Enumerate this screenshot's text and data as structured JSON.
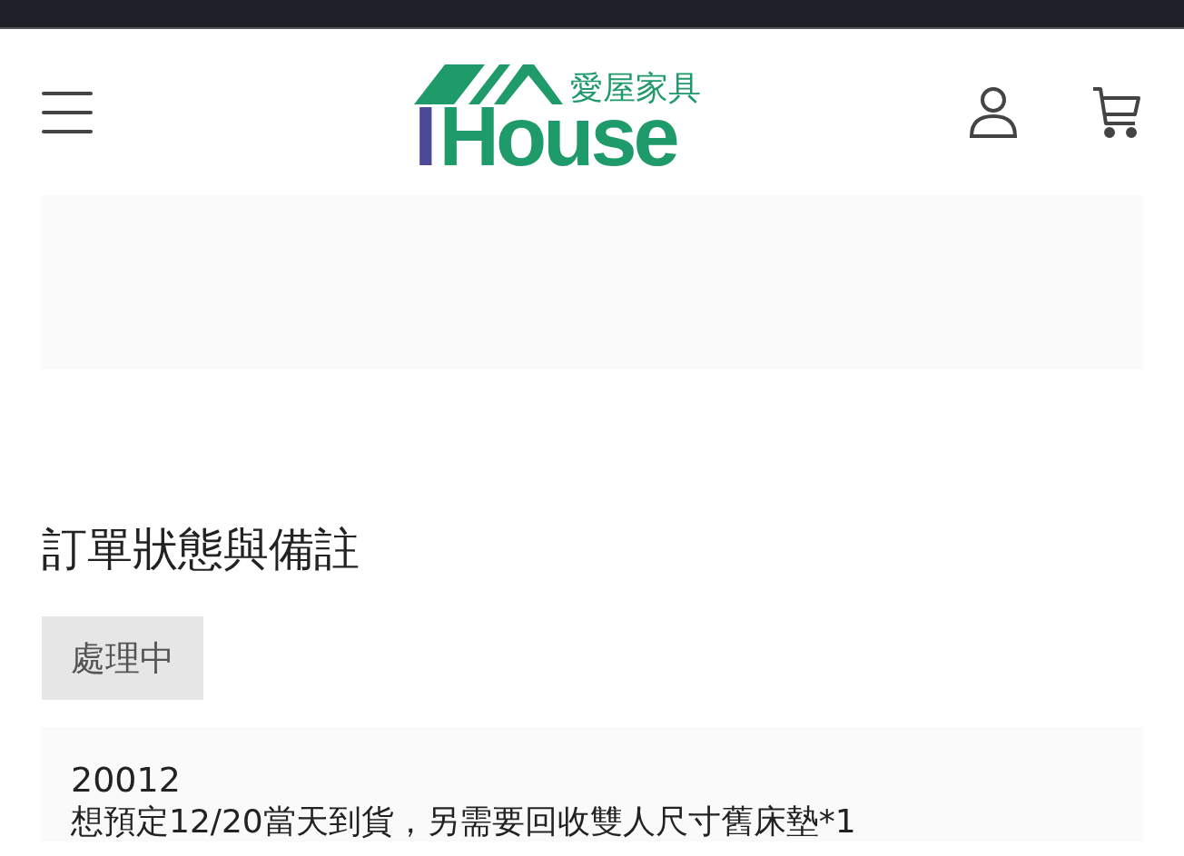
{
  "header": {
    "logo": {
      "tagline": "愛屋家具",
      "mark": "I",
      "word": "House"
    }
  },
  "order": {
    "title": "訂單狀態與備註",
    "status": "處理中",
    "note": {
      "number": "20012",
      "text": "想預定12/20當天到貨，另需要回收雙人尺寸舊床墊*1"
    }
  }
}
